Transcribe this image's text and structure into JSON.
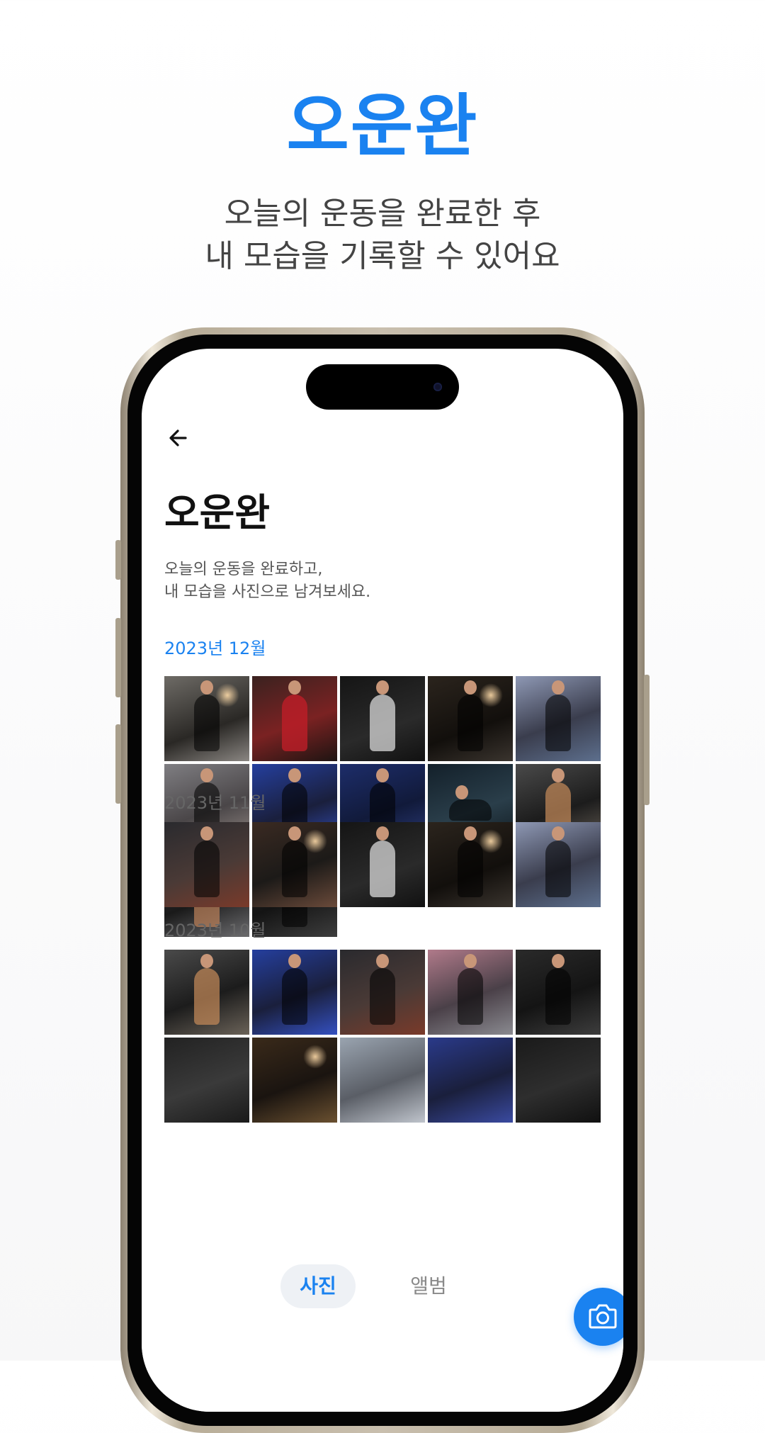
{
  "hero": {
    "title": "오운완",
    "subtitle_line1": "오늘의 운동을 완료한 후",
    "subtitle_line2": "내 모습을 기록할 수 있어요"
  },
  "app": {
    "back_icon": "arrow-left-icon",
    "title": "오운완",
    "description_line1": "오늘의 운동을 완료하고,",
    "description_line2": "내 모습을 사진으로 남겨보세요.",
    "accent_color": "#1a82f0",
    "sections": [
      {
        "month": "2023년 12월",
        "photo_count": 12
      },
      {
        "month": "2023년 11월",
        "photo_count": 5
      },
      {
        "month": "2023년 10월",
        "photo_count": 10
      }
    ],
    "camera_icon": "camera-icon",
    "tabs": [
      {
        "label": "사진",
        "active": true
      },
      {
        "label": "앨범",
        "active": false
      }
    ]
  }
}
